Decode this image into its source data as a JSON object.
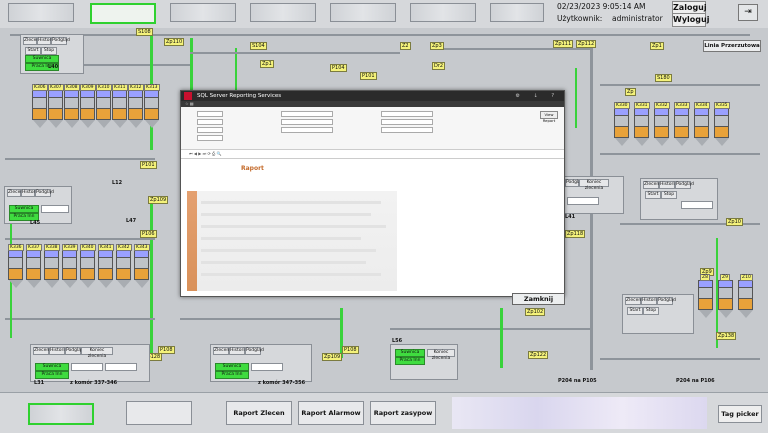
{
  "header": {
    "datetime": "02/23/2023 9:05:14 AM",
    "user_label": "Użytkownik:",
    "user_name": "administrator",
    "login_label": "Zaloguj",
    "logout_label": "Wyloguj",
    "exit_icon": "exit-icon"
  },
  "scada": {
    "line_label": "Linia Przerzutowa",
    "lines": [
      "L40",
      "L12",
      "L47",
      "L45",
      "L31",
      "L41",
      "L56"
    ],
    "silo_labels_top": [
      "K306",
      "K307",
      "K308",
      "K309",
      "K310",
      "K311",
      "K312",
      "K313"
    ],
    "silo_labels_mid": [
      "K336",
      "K337",
      "K338",
      "K339",
      "K340",
      "K341",
      "K342",
      "K343"
    ],
    "silo_labels_right": [
      "K330",
      "K331",
      "K332",
      "K333",
      "K334",
      "K335"
    ],
    "silo_labels_z": [
      "Z8",
      "Z9",
      "Z10"
    ],
    "panel_tabs": [
      "Zlecenia",
      "Historia",
      "Podgląd",
      "Koniec zlecenia"
    ],
    "panel_buttons": [
      "Start",
      "Stop"
    ],
    "panel_status": "Praca Inn",
    "panel_status2": "Suwnica",
    "range_label_1": "z komór 337-346",
    "range_label_2": "z komór 347-356",
    "footer_labels": [
      "P204 na P105",
      "P204 na P106"
    ]
  },
  "report_window": {
    "title": "SQL Server Reporting Services",
    "report_heading": "Raport",
    "view_report_button": "View Report",
    "close_button": "Zamknij"
  },
  "bottom": {
    "report_orders": "Raport Zlecen",
    "report_alarms": "Raport Alarmow",
    "report_recipes": "Raport zasypow",
    "tag_picker": "Tag picker"
  },
  "colors": {
    "active_green": "#39d23b",
    "tag_yellow": "#f4f27a",
    "silo_blue": "#9aa0ff",
    "silo_orange": "#e8a23a",
    "report_orange": "#c46a2a"
  }
}
